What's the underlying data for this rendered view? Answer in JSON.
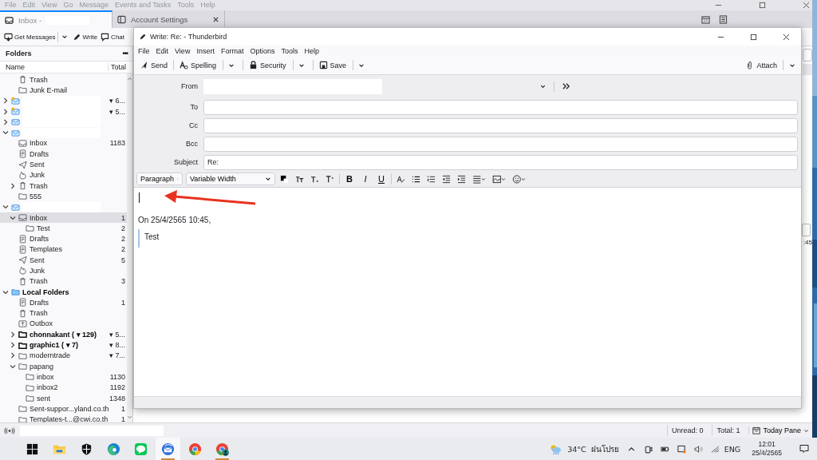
{
  "main_window": {
    "menu": [
      "File",
      "Edit",
      "View",
      "Go",
      "Message",
      "Events and Tasks",
      "Tools",
      "Help"
    ],
    "tabs": [
      {
        "label": "Inbox -",
        "kind": "mail",
        "selected": true,
        "closable": false
      },
      {
        "label": "Account Settings",
        "kind": "settings",
        "selected": false,
        "closable": true
      }
    ],
    "toolbar": [
      {
        "label": "Get Messages",
        "kind": "get",
        "menu": true
      },
      {
        "label": "Write",
        "kind": "write"
      },
      {
        "label": "Chat",
        "kind": "chat"
      }
    ],
    "folder_pane": {
      "title": "Folders",
      "more": "•••",
      "columns": [
        "Name",
        "Total"
      ],
      "folders": [
        {
          "children": [
            {
              "label": "Trash",
              "kind": "trash",
              "selected": false
            },
            {
              "label": "Junk E-mail",
              "kind": "folder",
              "selected": false
            }
          ]
        },
        {
          "kind": "account",
          "expanded": false,
          "new_mail": true,
          "count": "▾ 6...",
          "selected": false
        },
        {
          "kind": "account",
          "expanded": false,
          "new_mail": true,
          "count": "▾ 5...",
          "selected": false
        },
        {
          "kind": "account",
          "expanded": false,
          "new_mail": false,
          "selected": false
        },
        {
          "kind": "account",
          "expanded": true,
          "new_mail": false,
          "selected": false,
          "children": [
            {
              "label": "Inbox",
              "kind": "inbox",
              "count": "1183",
              "selected": false
            },
            {
              "label": "Drafts",
              "kind": "drafts",
              "selected": false
            },
            {
              "label": "Sent",
              "kind": "sent",
              "selected": false
            },
            {
              "label": "Junk",
              "kind": "junk",
              "selected": false
            },
            {
              "label": "Trash",
              "kind": "trash",
              "expanded": false,
              "selected": false
            },
            {
              "label": "555",
              "kind": "folder",
              "selected": false
            }
          ]
        },
        {
          "kind": "account",
          "expanded": true,
          "new_mail": false,
          "selected": false,
          "children": [
            {
              "label": "Inbox",
              "kind": "inbox",
              "count": "1",
              "expanded": true,
              "selected": true,
              "children": [
                {
                  "label": "Test",
                  "kind": "folder",
                  "count": "2",
                  "selected": false
                }
              ]
            },
            {
              "label": "Drafts",
              "kind": "drafts",
              "count": "2",
              "selected": false
            },
            {
              "label": "Templates",
              "kind": "templates",
              "count": "2",
              "selected": false
            },
            {
              "label": "Sent",
              "kind": "sent",
              "count": "5",
              "selected": false
            },
            {
              "label": "Junk",
              "kind": "junk",
              "selected": false
            },
            {
              "label": "Trash",
              "kind": "trash",
              "count": "3",
              "selected": false
            }
          ]
        },
        {
          "label": "Local Folders",
          "kind": "local",
          "bold": true,
          "expanded": true,
          "selected": false,
          "children": [
            {
              "label": "Drafts",
              "kind": "drafts",
              "count": "1",
              "selected": false
            },
            {
              "label": "Trash",
              "kind": "trash",
              "selected": false
            },
            {
              "label": "Outbox",
              "kind": "outbox",
              "selected": false
            },
            {
              "label": "chonnakant ( ▾ 129)",
              "kind": "folder",
              "bold": true,
              "expanded": false,
              "count": "▾ 5...",
              "selected": false
            },
            {
              "label": "graphic1 ( ▾ 7)",
              "kind": "folder",
              "bold": true,
              "expanded": false,
              "count": "▾ 8...",
              "selected": false
            },
            {
              "label": "moderntrade",
              "kind": "folder",
              "expanded": false,
              "count": "▾ 7...",
              "selected": false
            },
            {
              "label": "papang",
              "kind": "folder",
              "expanded": true,
              "selected": false,
              "children": [
                {
                  "label": "inbox",
                  "kind": "folder",
                  "count": "1130",
                  "selected": false
                },
                {
                  "label": "inbox2",
                  "kind": "folder",
                  "count": "1192",
                  "selected": false
                },
                {
                  "label": "sent",
                  "kind": "folder",
                  "count": "1348",
                  "selected": false
                }
              ]
            },
            {
              "label": "Sent-suppor...yland.co.th",
              "kind": "folder",
              "count": "1",
              "selected": false
            },
            {
              "label": "Templates-t...@cwi.co.th",
              "kind": "folder",
              "count": "1",
              "selected": false
            }
          ]
        }
      ]
    },
    "message_list": {
      "time": ":45"
    },
    "status_bar": {
      "unread": "Unread: 0",
      "total": "Total: 1",
      "today_pane": "Today Pane"
    }
  },
  "compose": {
    "title": "Write: Re: - Thunderbird",
    "menu": [
      "File",
      "Edit",
      "View",
      "Insert",
      "Format",
      "Options",
      "Tools",
      "Help"
    ],
    "toolbar": [
      {
        "label": "Send",
        "kind": "send"
      },
      {
        "label": "Spelling",
        "kind": "spelling",
        "menu": true
      },
      {
        "label": "Security",
        "kind": "security",
        "menu": true
      },
      {
        "label": "Save",
        "kind": "save",
        "menu": true
      }
    ],
    "attach": "Attach",
    "fields": [
      {
        "label": "From",
        "kind": "from"
      },
      {
        "label": "To",
        "kind": "address"
      },
      {
        "label": "Cc",
        "kind": "address"
      },
      {
        "label": "Bcc",
        "kind": "address"
      },
      {
        "label": "Subject",
        "kind": "text",
        "value": "Re:"
      }
    ],
    "format": {
      "paragraph": "Paragraph",
      "font": "Variable Width",
      "style_buttons": [
        "B",
        "I",
        "U"
      ]
    },
    "body": {
      "attribution": "On 25/4/2565 10:45,",
      "quote": "Test"
    }
  },
  "taskbar": {
    "apps": [
      {
        "kind": "start",
        "running": false,
        "selected": false
      },
      {
        "kind": "explorer",
        "running": false,
        "selected": false
      },
      {
        "kind": "security",
        "running": false,
        "selected": false
      },
      {
        "kind": "edge",
        "running": false,
        "selected": false
      },
      {
        "kind": "line",
        "running": false,
        "selected": false
      },
      {
        "kind": "thunderbird",
        "running": true,
        "selected": true
      },
      {
        "kind": "chrome",
        "running": false,
        "selected": false
      },
      {
        "kind": "chrome_profile",
        "running": true,
        "selected": false
      }
    ],
    "weather": {
      "temp": "34°C",
      "condition": "ฝนโปรย"
    },
    "language": "ENG",
    "time": "12:01",
    "date": "25/4/2565"
  }
}
